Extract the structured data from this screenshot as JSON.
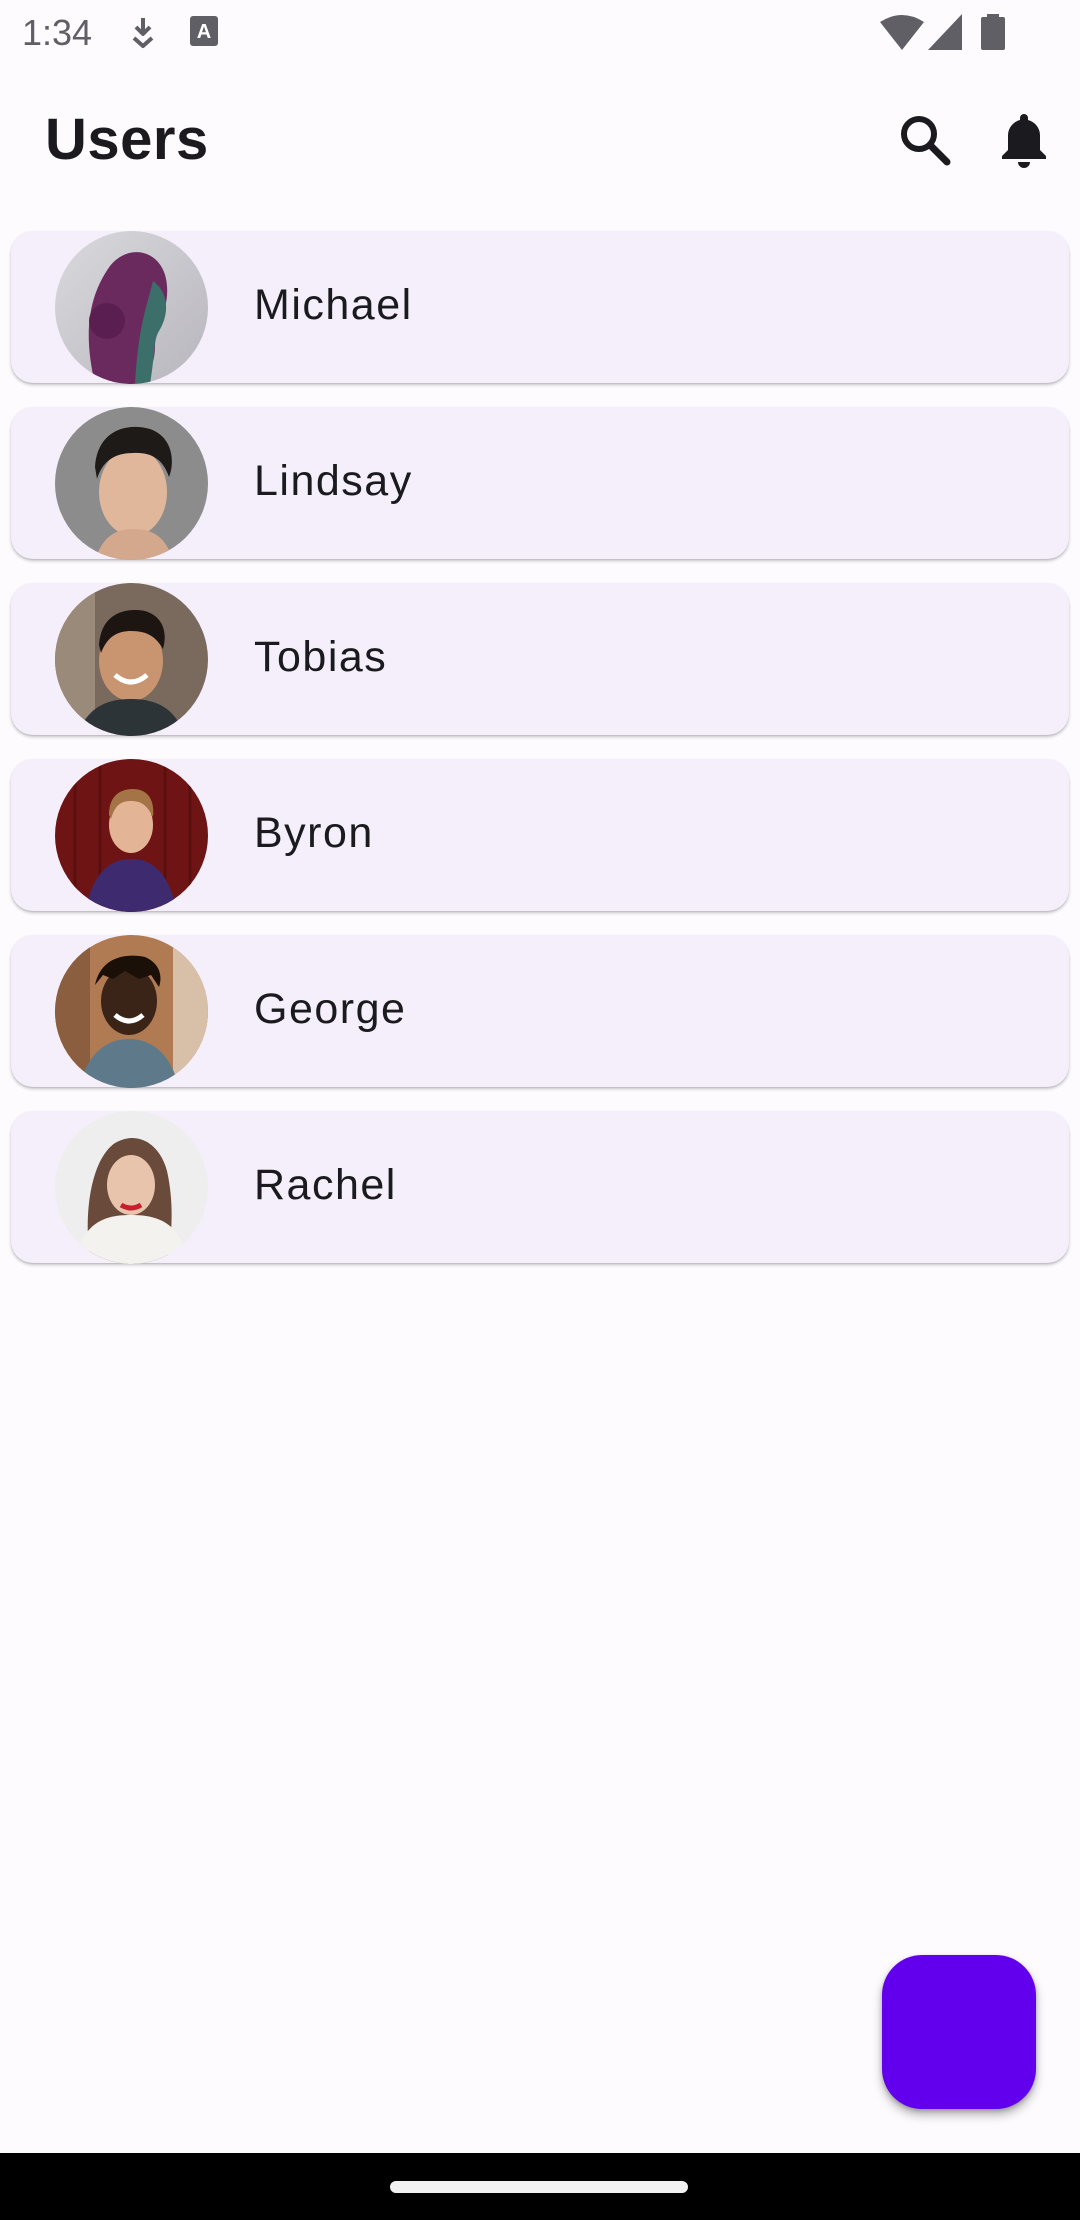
{
  "status_bar": {
    "time": "1:34",
    "icons": [
      "download-icon",
      "keyboard-a-icon",
      "wifi-icon",
      "cellular-signal-icon",
      "battery-icon"
    ]
  },
  "app_bar": {
    "title": "Users",
    "actions": [
      "search-icon",
      "notifications-bell-icon"
    ]
  },
  "users": [
    {
      "name": "Michael",
      "avatar_colors": [
        "#cfcfd3",
        "#6a2a5e"
      ]
    },
    {
      "name": "Lindsay",
      "avatar_colors": [
        "#8e8e8e",
        "#e0b79a"
      ]
    },
    {
      "name": "Tobias",
      "avatar_colors": [
        "#7a6a5e",
        "#c99470"
      ]
    },
    {
      "name": "Byron",
      "avatar_colors": [
        "#6e1414",
        "#3e2a6e"
      ]
    },
    {
      "name": "George",
      "avatar_colors": [
        "#b07a52",
        "#3a2418"
      ]
    },
    {
      "name": "Rachel",
      "avatar_colors": [
        "#eeeeee",
        "#c28a6e"
      ]
    }
  ],
  "colors": {
    "background": "#fefbff",
    "card": "#f4effa",
    "fab": "#6200ee",
    "text": "#1b1b1f"
  }
}
